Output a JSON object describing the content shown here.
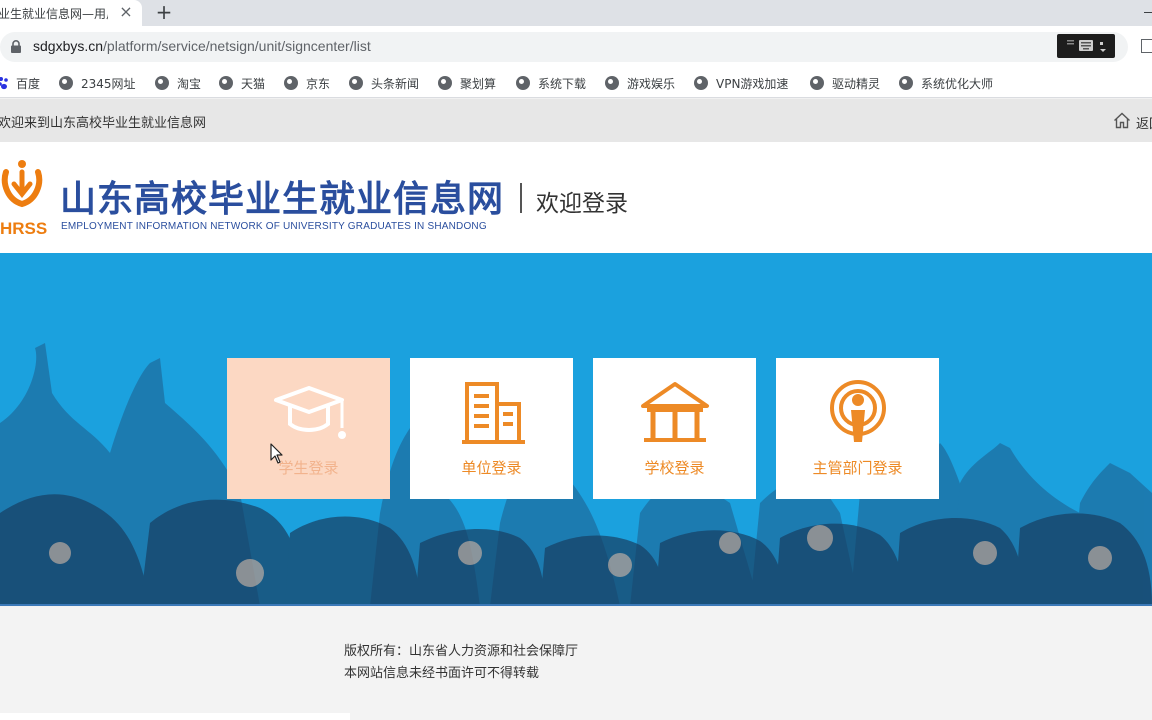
{
  "browser": {
    "tab_title": "业生就业信息网—用户",
    "tab_close": "×",
    "new_tab": "+",
    "url_host": "sdgxbys.cn",
    "url_path": "/platform/service/netsign/unit/signcenter/list"
  },
  "bookmarks": [
    {
      "label": "百度",
      "icon": "baidu-paw-icon"
    },
    {
      "label": "2345网址",
      "icon": "globe-icon"
    },
    {
      "label": "淘宝",
      "icon": "globe-icon"
    },
    {
      "label": "天猫",
      "icon": "globe-icon"
    },
    {
      "label": "京东",
      "icon": "globe-icon"
    },
    {
      "label": "头条新闻",
      "icon": "globe-icon"
    },
    {
      "label": "聚划算",
      "icon": "globe-icon"
    },
    {
      "label": "系统下载",
      "icon": "globe-icon"
    },
    {
      "label": "游戏娱乐",
      "icon": "globe-icon"
    },
    {
      "label": "VPN游戏加速",
      "icon": "globe-icon"
    },
    {
      "label": "驱动精灵",
      "icon": "globe-icon"
    },
    {
      "label": "系统优化大师",
      "icon": "globe-icon"
    }
  ],
  "topbar": {
    "welcome": "欢迎来到山东高校毕业生就业信息网",
    "home": "返回首页"
  },
  "header": {
    "logo_text": "HRSS",
    "title": "山东高校毕业生就业信息网",
    "subtitle": "EMPLOYMENT INFORMATION NETWORK OF UNIVERSITY GRADUATES IN SHANDONG",
    "welcome_login": "欢迎登录"
  },
  "login_options": [
    {
      "label": "学生登录",
      "icon": "graduation-cap-icon",
      "active": true
    },
    {
      "label": "单位登录",
      "icon": "office-building-icon",
      "active": false
    },
    {
      "label": "学校登录",
      "icon": "school-building-icon",
      "active": false
    },
    {
      "label": "主管部门登录",
      "icon": "podcast-person-icon",
      "active": false
    }
  ],
  "footer": {
    "copyright": "版权所有：山东省人力资源和社会保障厅",
    "notice": "本网站信息未经书面许可不得转载"
  },
  "colors": {
    "banner_blue": "#1ba1de",
    "title_blue": "#2a4e9e",
    "accent_orange": "#ed8a26",
    "active_card": "#fcd8c3"
  }
}
